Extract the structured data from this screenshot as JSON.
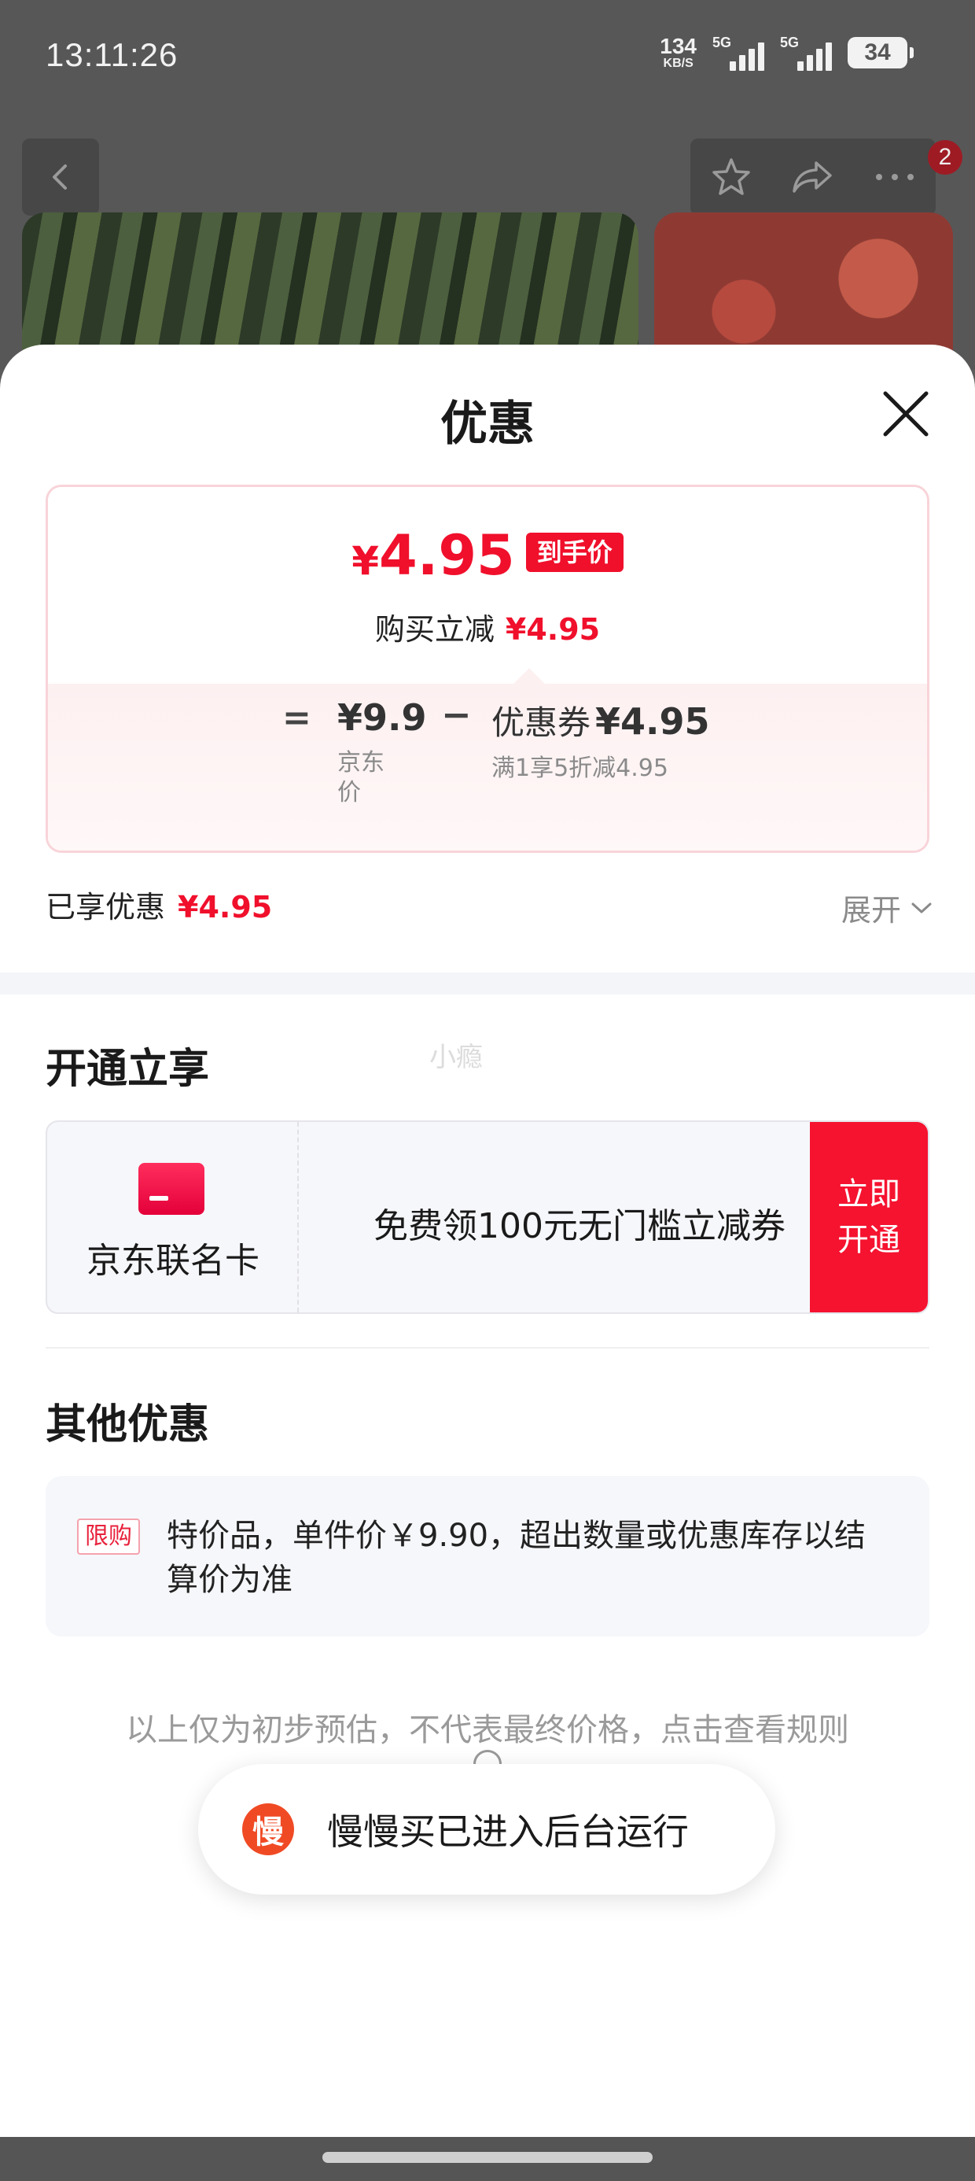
{
  "status_bar": {
    "time": "13:11:26",
    "net_speed": "134",
    "net_unit": "KB/S",
    "signal1": "5G",
    "signal2": "5G",
    "battery": "34"
  },
  "product_nav": {
    "badge_count": "2",
    "icons": [
      "back-icon",
      "star-icon",
      "share-icon",
      "more-icon"
    ]
  },
  "sheet": {
    "title": "优惠",
    "price_card": {
      "final_price": "4.95",
      "currency": "¥",
      "final_tag": "到手价",
      "reduce_label": "购买立减",
      "reduce_amount": "¥4.95",
      "equals": "=",
      "jd_price": "¥9.9",
      "jd_price_label": "京东价",
      "minus": "−",
      "coupon_label": "优惠券",
      "coupon_amount": "¥4.95",
      "coupon_rule": "满1享5折减4.95"
    },
    "enjoyed_label": "已享优惠",
    "enjoyed_amount": "¥4.95",
    "expand_label": "展开",
    "watermark": "小瘾",
    "open_section": {
      "title": "开通立享",
      "card_name": "京东联名卡",
      "card_desc": "免费领100元无门槛立减券",
      "open_button": "立即\n开通"
    },
    "other_section": {
      "title": "其他优惠",
      "tag": "限购",
      "text": "特价品，单件价￥9.90，超出数量或优惠库存以结算价为准"
    },
    "disclaimer": "以上仅为初步预估，不代表最终价格，点击查看规则"
  },
  "toast": {
    "icon_char": "慢",
    "text": "慢慢买已进入后台运行"
  },
  "colors": {
    "accent_red": "#f0102c",
    "open_button_red": "#f51330",
    "card_icon": "#ff2e5d",
    "toast_icon": "#f04a24"
  }
}
